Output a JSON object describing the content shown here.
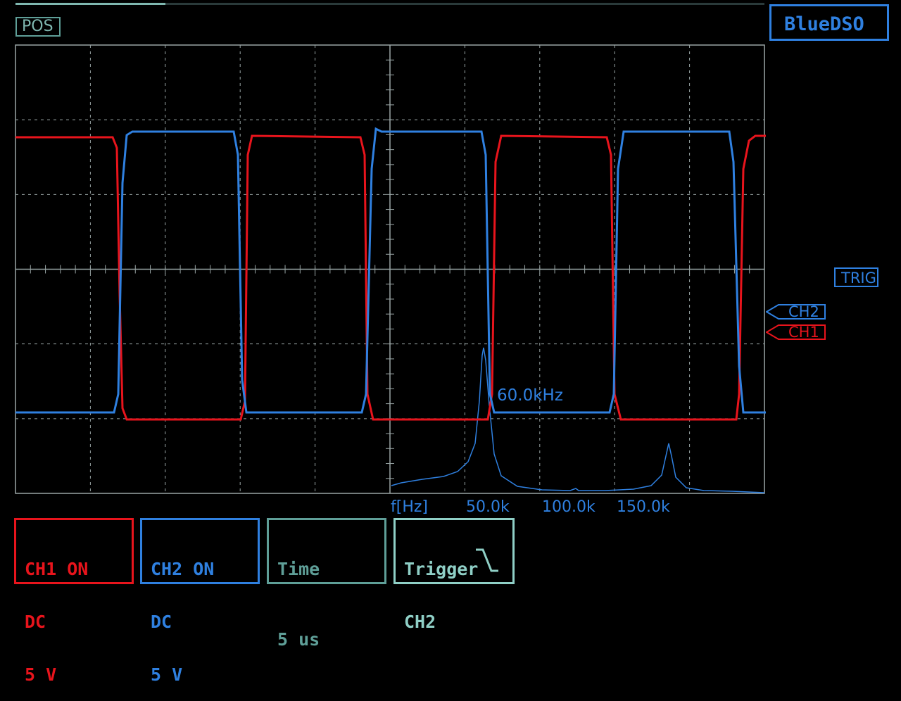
{
  "header": {
    "position_label": "POS",
    "brand": "BlueDSO",
    "position_progress": 0.2
  },
  "colors": {
    "ch1": "#e8141c",
    "ch2": "#2f80e0",
    "grid": "#9aa6a6",
    "time": "#5f9f98",
    "trigger": "#8fcfc6"
  },
  "markers": {
    "trig": "TRIG",
    "ch2": "CH2",
    "ch1": "CH1"
  },
  "spectrum": {
    "peak_label": "60.0kHz",
    "axis_unit": "f[Hz]",
    "ticks": [
      "50.0k",
      "100.0k",
      "150.0k"
    ]
  },
  "panels": {
    "ch1": {
      "line1": "CH1 ON",
      "line2": "DC",
      "line3": "5 V"
    },
    "ch2": {
      "line1": "CH2 ON",
      "line2": "DC",
      "line3": "5 V"
    },
    "time": {
      "line1": "Time",
      "line2": "5 us"
    },
    "trigger": {
      "line1": "Trigger",
      "line2": "CH2"
    }
  }
}
